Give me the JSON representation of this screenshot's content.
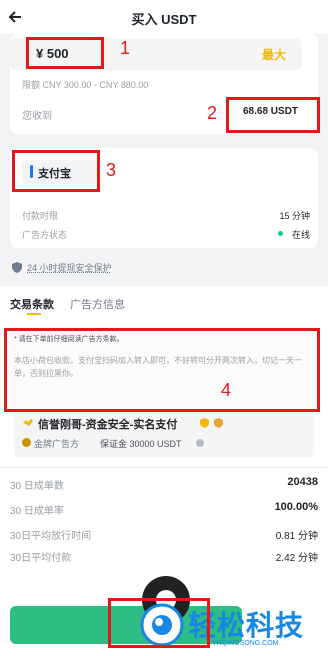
{
  "header": {
    "title": "买入 USDT"
  },
  "amount": {
    "value": "¥ 500",
    "max_label": "最大",
    "limit": "限额 CNY 300.00 - CNY 880.00",
    "receive_label": "您收到",
    "receive_value": "68.68 USDT"
  },
  "payment": {
    "method": "支付宝",
    "rows": [
      {
        "label": "付款时限",
        "value": "15 分钟"
      },
      {
        "label": "广告方状态",
        "value": "在线"
      }
    ],
    "status_color": "#0ecb81"
  },
  "protection": "24 小时提现安全保护",
  "tabs": [
    "交易条款",
    "广告方信息"
  ],
  "terms": {
    "note": "* 请在下单前仔细阅读广告方条款。",
    "body": "本店小荷包收款。支付宝扫码加入转入即可，不好转可分开两次转入，切记一天一单，否则拉黑你。"
  },
  "merchant": {
    "name": "信誉刚哥-资金安全-实名支付",
    "ad_label": "金牌广告方",
    "deposit": "保证金 30000 USDT"
  },
  "stats": [
    {
      "label": "30 日成单数",
      "value": "20438"
    },
    {
      "label": "30 日成单率",
      "value": "100.00%"
    },
    {
      "label": "30日平均放行时间",
      "value": "0.81 分钟"
    },
    {
      "label": "30日平均付款",
      "value": "2.42 分钟"
    }
  ],
  "annotations": [
    "1",
    "2",
    "3",
    "4"
  ],
  "watermark": {
    "text": "轻松科技",
    "sub": "YNQINGSONG.COM"
  },
  "colors": {
    "accent": "#f0b90b",
    "buy": "#2ebd85",
    "annotation": "#e31919",
    "watermark": "#1787e6"
  }
}
